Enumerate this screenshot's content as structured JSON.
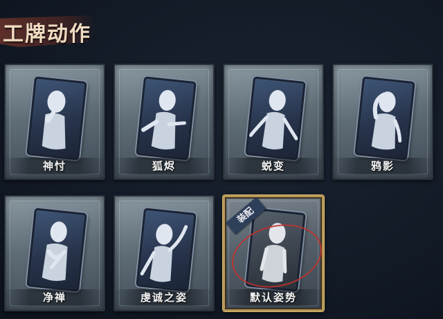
{
  "page": {
    "title": "工牌动作"
  },
  "cards": [
    {
      "id": "shenfu",
      "label": "神忖",
      "equipped": false,
      "pose": "chin"
    },
    {
      "id": "huwen",
      "label": "狐烬",
      "equipped": false,
      "pose": "point"
    },
    {
      "id": "tuibian",
      "label": "蜕变",
      "equipped": false,
      "pose": "open"
    },
    {
      "id": "yaying",
      "label": "鸦影",
      "equipped": false,
      "pose": "forehead"
    },
    {
      "id": "jingchan",
      "label": "净禅",
      "equipped": false,
      "pose": "pray"
    },
    {
      "id": "qiancheng",
      "label": "虔诚之姿",
      "equipped": false,
      "pose": "raise"
    },
    {
      "id": "moren",
      "label": "默认姿势",
      "equipped": true,
      "pose": "stand",
      "equip_badge": "装配"
    }
  ],
  "colors": {
    "equipped_border": "#d8b86b",
    "highlight_ring": "#c0322e",
    "label_text": "#f3f3f3"
  }
}
